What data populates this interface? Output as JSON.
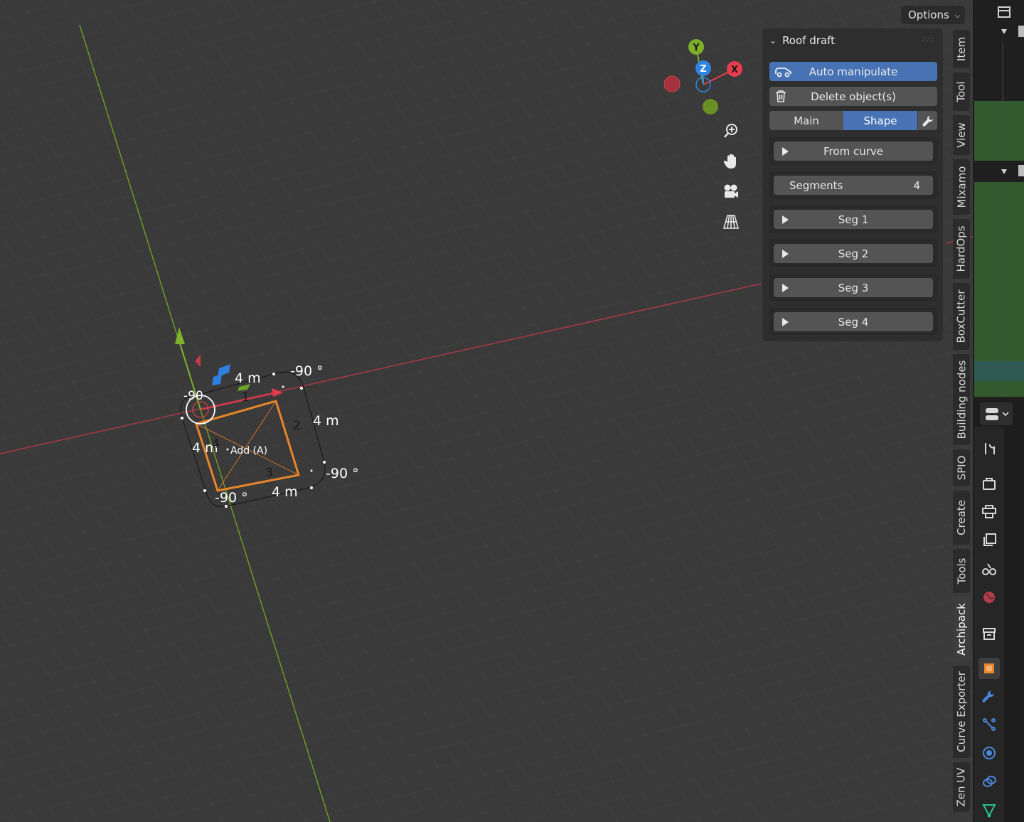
{
  "header": {
    "options_label": "Options"
  },
  "gizmo": {
    "x_label": "X",
    "y_label": "Y",
    "z_label": "Z",
    "colors": {
      "x": "#e53d4f",
      "y": "#7fae2a",
      "z": "#2f84e3"
    }
  },
  "viewport_tools": [
    "zoom-icon",
    "pan-hand-icon",
    "camera-icon",
    "perspective-grid-icon"
  ],
  "overlay": {
    "dim_top": "4 m",
    "dim_right": "4 m",
    "dim_left": "4 m",
    "dim_bottom": "4 m",
    "angle_top": "-90 °",
    "angle_right": "-90 °",
    "angle_bottom": "-90 °",
    "angle_left": "-90",
    "seg_labels": [
      "1",
      "2",
      "3",
      "4"
    ],
    "add_hint": "Add (A)"
  },
  "panel": {
    "title": "Roof draft",
    "auto_manipulate": "Auto manipulate",
    "delete_objects": "Delete object(s)",
    "tabs": {
      "main": "Main",
      "shape": "Shape"
    },
    "from_curve": "From curve",
    "segments_label": "Segments",
    "segments_value": "4",
    "segs": [
      "Seg 1",
      "Seg 2",
      "Seg 3",
      "Seg 4"
    ]
  },
  "vertical_tabs": [
    "Item",
    "Tool",
    "View",
    "Mixamo",
    "HardOps",
    "BoxCutter",
    "Building nodes",
    "SPIO",
    "Create",
    "Tools",
    "Archipack",
    "Curve Exporter",
    "Zen UV"
  ],
  "active_vertical_tab": "Archipack",
  "colors": {
    "accent": "#4772b3",
    "outliner_green": "#325a2e",
    "selection_orange": "#e8852a"
  }
}
